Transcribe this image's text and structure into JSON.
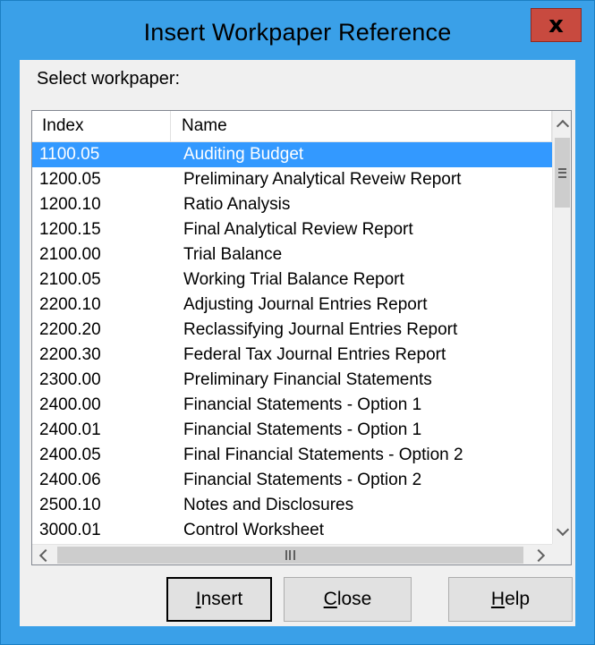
{
  "window": {
    "title": "Insert Workpaper Reference",
    "close_glyph": "x"
  },
  "prompt": "Select workpaper:",
  "list": {
    "columns": {
      "index": "Index",
      "name": "Name"
    },
    "selected_index": 0,
    "rows": [
      {
        "index": "1100.05",
        "name": "Auditing Budget"
      },
      {
        "index": "1200.05",
        "name": "Preliminary Analytical Reveiw Report"
      },
      {
        "index": "1200.10",
        "name": "Ratio Analysis"
      },
      {
        "index": "1200.15",
        "name": "Final Analytical Review Report"
      },
      {
        "index": "2100.00",
        "name": "Trial Balance"
      },
      {
        "index": "2100.05",
        "name": "Working Trial Balance Report"
      },
      {
        "index": "2200.10",
        "name": "Adjusting Journal Entries Report"
      },
      {
        "index": "2200.20",
        "name": "Reclassifying Journal Entries Report"
      },
      {
        "index": "2200.30",
        "name": "Federal Tax Journal Entries Report"
      },
      {
        "index": "2300.00",
        "name": "Preliminary Financial Statements"
      },
      {
        "index": "2400.00",
        "name": "Financial Statements - Option 1"
      },
      {
        "index": "2400.01",
        "name": "Financial Statements - Option 1"
      },
      {
        "index": "2400.05",
        "name": "Final Financial Statements - Option 2"
      },
      {
        "index": "2400.06",
        "name": "Financial Statements - Option 2"
      },
      {
        "index": "2500.10",
        "name": "Notes and Disclosures"
      },
      {
        "index": "3000.01",
        "name": "Control Worksheet"
      }
    ]
  },
  "buttons": {
    "insert": {
      "accel": "I",
      "rest": "nsert"
    },
    "close": {
      "accel": "C",
      "rest": "lose"
    },
    "help": {
      "accel": "H",
      "rest": "elp"
    }
  },
  "colors": {
    "title_bar": "#3aa0e8",
    "close_button": "#c84a3f",
    "selection": "#3399ff",
    "client_bg": "#f0f0f0"
  },
  "icons": [
    "close-icon",
    "scroll-up-icon",
    "scroll-down-icon",
    "scroll-left-icon",
    "scroll-right-icon"
  ]
}
